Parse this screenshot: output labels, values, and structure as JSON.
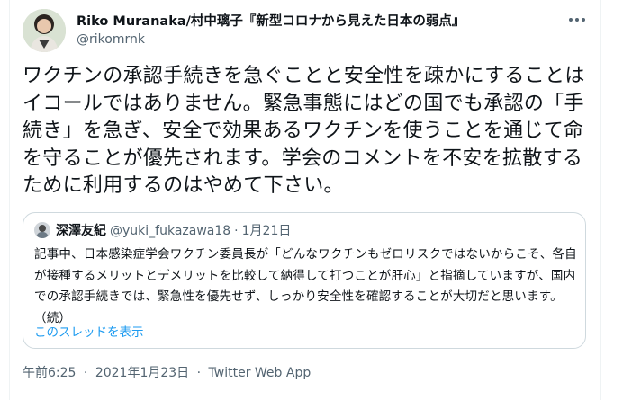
{
  "author": {
    "display_name": "Riko Muranaka/村中璃子『新型コロナから見えた日本の弱点』",
    "handle": "@rikomrnk"
  },
  "tweet_text": "ワクチンの承認手続きを急ぐことと安全性を疎かにすることはイコールではありません。緊急事態にはどの国でも承認の「手続き」を急ぎ、安全で効果あるワクチンを使うことを通じて命を守ることが優先されます。学会のコメントを不安を拡散するために利用するのはやめて下さい。",
  "quoted": {
    "display_name": "深澤友紀",
    "handle": "@yuki_fukazawa18",
    "separator": "·",
    "date": "1月21日",
    "text": "記事中、日本感染症学会ワクチン委員長が「どんなワクチンもゼロリスクではないからこそ、各自が接種するメリットとデメリットを比較して納得して打つことが肝心」と指摘していますが、国内での承認手続きでは、緊急性を優先せず、しっかり安全性を確認することが大切だと思います。（続）",
    "thread_link": "このスレッドを表示"
  },
  "footer": {
    "time": "午前6:25",
    "sep1": "·",
    "date": "2021年1月23日",
    "sep2": "·",
    "client": "Twitter Web App"
  },
  "colors": {
    "text": "#0f1419",
    "secondary": "#536471",
    "link": "#1d9bf0",
    "border": "#cfd9de"
  }
}
